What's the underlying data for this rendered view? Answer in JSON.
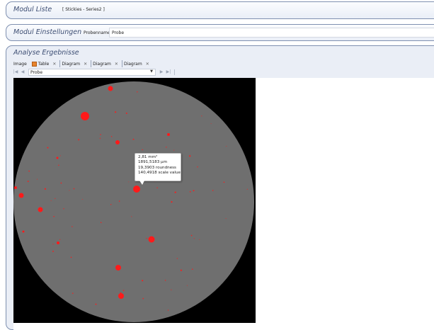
{
  "modul_liste": {
    "title": "Modul Liste",
    "series": "[ Stickies - Series2 ]"
  },
  "modul_einstellungen": {
    "title": "Modul Einstellungen",
    "probenname_label": "Probenname",
    "probenname_value": "Probe"
  },
  "analyse": {
    "title": "Analyse Ergebnisse",
    "tabs": [
      {
        "label": "Image"
      },
      {
        "label": "Table"
      },
      {
        "label": "Diagram"
      },
      {
        "label": "Diagram"
      },
      {
        "label": "Diagram"
      }
    ],
    "probe_select": "Probe",
    "tooltip": {
      "area": "2,81 mm²",
      "perimeter": "1891,5183 µm",
      "roundness": "19,3903 roundness",
      "scale": "140,4918 scale value"
    }
  },
  "colors": {
    "particle": "#ff1a1a",
    "sample_disc": "#6f6f6f",
    "background": "#000000",
    "panel_border": "#7f90b0"
  },
  "icons": {
    "first": "first-page-icon",
    "prev": "previous-icon",
    "next": "next-icon",
    "last": "last-page-icon",
    "close": "close-icon",
    "table": "table-icon"
  }
}
